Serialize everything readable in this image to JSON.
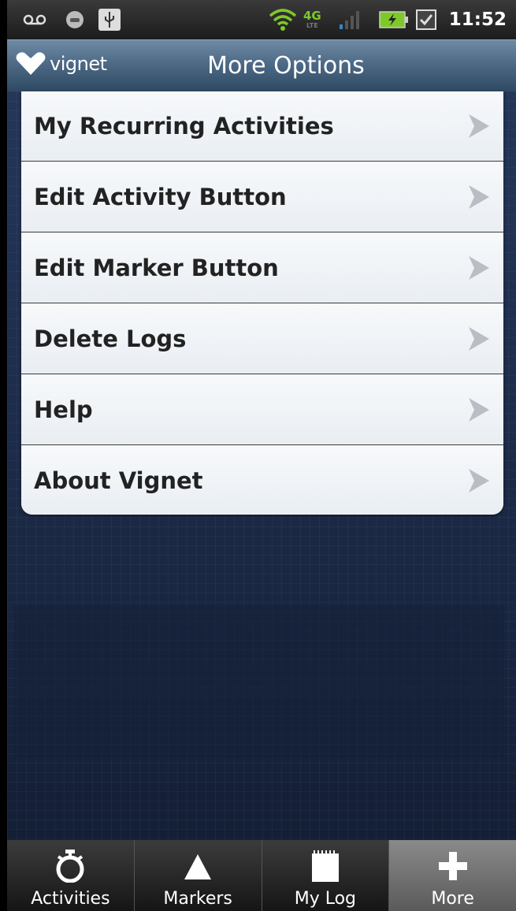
{
  "status_bar": {
    "time": "11:52",
    "network": "4G",
    "network_sub": "LTE",
    "icons": [
      "voicemail-icon",
      "notification-icon",
      "usb-icon",
      "wifi-icon",
      "signal-icon",
      "battery-charging-icon",
      "checkbox-icon"
    ]
  },
  "header": {
    "logo_text": "vignet",
    "title": "More Options"
  },
  "menu": {
    "items": [
      {
        "label": "My Recurring Activities"
      },
      {
        "label": "Edit Activity Button"
      },
      {
        "label": "Edit Marker Button"
      },
      {
        "label": "Delete Logs"
      },
      {
        "label": "Help"
      },
      {
        "label": "About Vignet"
      }
    ]
  },
  "tabs": [
    {
      "label": "Activities",
      "icon": "stopwatch-icon"
    },
    {
      "label": "Markers",
      "icon": "triangle-icon"
    },
    {
      "label": "My Log",
      "icon": "notepad-icon"
    },
    {
      "label": "More",
      "icon": "plus-icon",
      "selected": true
    }
  ],
  "colors": {
    "accent_green": "#7ec82a",
    "title_bar": "#4d6a86",
    "background": "#1f3052"
  }
}
